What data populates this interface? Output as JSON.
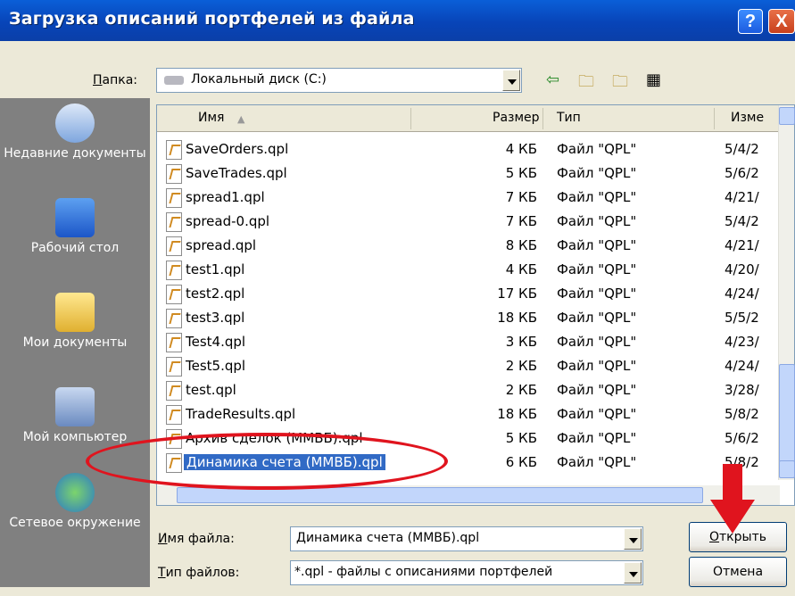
{
  "window": {
    "title": "Загрузка описаний портфелей из файла",
    "help_label": "?",
    "close_label": "X"
  },
  "lookin": {
    "label_u": "П",
    "label_rest": "апка:",
    "value": "Локальный диск (C:)"
  },
  "toolbar": {
    "back_icon": "back-arrow-icon",
    "up_icon": "up-folder-icon",
    "newfolder_icon": "new-folder-icon",
    "view_icon": "view-menu-icon"
  },
  "places": [
    {
      "label": "Недавние документы",
      "icon": "recent-docs-icon"
    },
    {
      "label": "Рабочий стол",
      "icon": "desktop-icon"
    },
    {
      "label": "Мои документы",
      "icon": "my-documents-icon"
    },
    {
      "label": "Мой компьютер",
      "icon": "my-computer-icon"
    },
    {
      "label": "Сетевое окружение",
      "icon": "network-icon"
    }
  ],
  "columns": {
    "name": "Имя",
    "size": "Размер",
    "type": "Тип",
    "date": "Изме"
  },
  "files": [
    {
      "name": "SaveOrders.qpl",
      "size": "4 КБ",
      "type": "Файл \"QPL\"",
      "date": "5/4/2"
    },
    {
      "name": "SaveTrades.qpl",
      "size": "5 КБ",
      "type": "Файл \"QPL\"",
      "date": "5/6/2"
    },
    {
      "name": "spread1.qpl",
      "size": "7 КБ",
      "type": "Файл \"QPL\"",
      "date": "4/21/"
    },
    {
      "name": "spread-0.qpl",
      "size": "7 КБ",
      "type": "Файл \"QPL\"",
      "date": "5/4/2"
    },
    {
      "name": "spread.qpl",
      "size": "8 КБ",
      "type": "Файл \"QPL\"",
      "date": "4/21/"
    },
    {
      "name": "test1.qpl",
      "size": "4 КБ",
      "type": "Файл \"QPL\"",
      "date": "4/20/"
    },
    {
      "name": "test2.qpl",
      "size": "17 КБ",
      "type": "Файл \"QPL\"",
      "date": "4/24/"
    },
    {
      "name": "test3.qpl",
      "size": "18 КБ",
      "type": "Файл \"QPL\"",
      "date": "5/5/2"
    },
    {
      "name": "Test4.qpl",
      "size": "3 КБ",
      "type": "Файл \"QPL\"",
      "date": "4/23/"
    },
    {
      "name": "Test5.qpl",
      "size": "2 КБ",
      "type": "Файл \"QPL\"",
      "date": "4/24/"
    },
    {
      "name": "test.qpl",
      "size": "2 КБ",
      "type": "Файл \"QPL\"",
      "date": "3/28/"
    },
    {
      "name": "TradeResults.qpl",
      "size": "18 КБ",
      "type": "Файл \"QPL\"",
      "date": "5/8/2"
    },
    {
      "name": "Архив сделок (ММВБ).qpl",
      "size": "5 КБ",
      "type": "Файл \"QPL\"",
      "date": "5/6/2"
    },
    {
      "name": "Динамика счета (ММВБ).qpl",
      "size": "6 КБ",
      "type": "Файл \"QPL\"",
      "date": "5/8/2"
    }
  ],
  "filename": {
    "label_u": "И",
    "label_rest": "мя файла:",
    "value": "Динамика счета (ММВБ).qpl"
  },
  "filetype": {
    "label_u": "Т",
    "label_rest": "ип файлов:",
    "value": "*.qpl - файлы с описаниями портфелей"
  },
  "buttons": {
    "open_u": "О",
    "open_rest": "ткрыть",
    "cancel": "Отмена"
  }
}
